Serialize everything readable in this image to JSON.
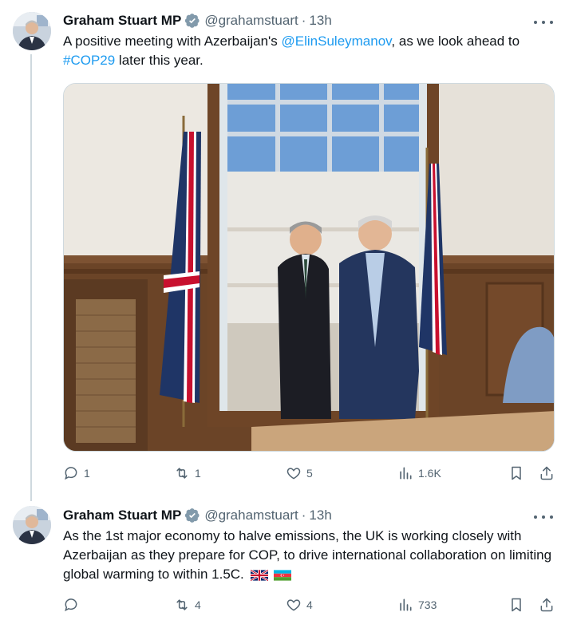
{
  "tweets": [
    {
      "author_name": "Graham Stuart MP",
      "handle": "@grahamstuart",
      "separator": "·",
      "time": "13h",
      "text_parts": [
        "A positive meeting with Azerbaijan's ",
        "@ElinSuleymanov",
        ", as we look ahead to ",
        "#COP29",
        " later this year."
      ],
      "replies": "1",
      "reposts": "1",
      "likes": "5",
      "views": "1.6K"
    },
    {
      "author_name": "Graham Stuart MP",
      "handle": "@grahamstuart",
      "separator": "·",
      "time": "13h",
      "text": "As the 1st major economy to halve emissions, the UK is working closely with Azerbaijan as they prepare for COP, to drive international collaboration on limiting global warming to within 1.5C.",
      "flags": [
        "uk-flag-emoji",
        "azerbaijan-flag-emoji"
      ],
      "replies": "",
      "reposts": "4",
      "likes": "4",
      "views": "733"
    }
  ],
  "colors": {
    "text": "#0f1419",
    "secondary": "#536471",
    "link": "#1d9bf0",
    "verified_badge": "#829aab",
    "thread_line": "#cfd9de"
  },
  "icons": [
    "reply-icon",
    "repost-icon",
    "like-icon",
    "views-icon",
    "bookmark-icon",
    "share-icon",
    "verified-badge-icon",
    "more-icon"
  ]
}
